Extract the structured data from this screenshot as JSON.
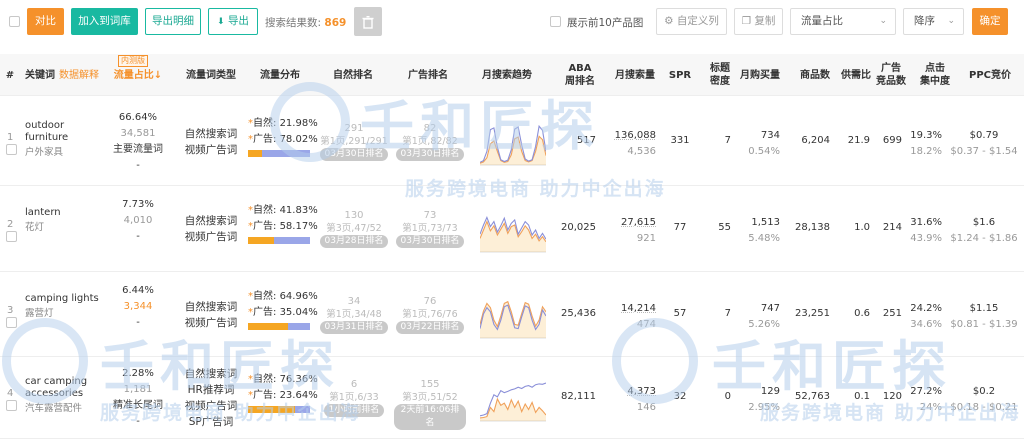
{
  "toolbar": {
    "compare": "对比",
    "add_to_lib": "加入到词库",
    "export_detail": "导出明细",
    "export": "导出",
    "result_label": "搜索结果数:",
    "result_count": "869",
    "top10_label": "展示前10产品图",
    "custom_cols": "自定义列",
    "copy": "复制",
    "sort_field": "流量占比",
    "sort_order": "降序",
    "confirm": "确定"
  },
  "header": {
    "index": "#",
    "keyword": "关键词",
    "data_explain": "数据解释",
    "beta": "内测版",
    "traffic_share": "流量占比↓",
    "traffic_type": "流量词类型",
    "traffic_dist": "流量分布",
    "natural_rank": "自然排名",
    "ad_rank": "广告排名",
    "monthly_trend": "月搜索趋势",
    "aba_1": "ABA",
    "aba_2": "周排名",
    "monthly_search": "月搜索量",
    "spr": "SPR",
    "title_density_1": "标题",
    "title_density_2": "密度",
    "monthly_purchase": "月购买量",
    "product_count": "商品数",
    "supply_demand": "供需比",
    "ad_products_1": "广告",
    "ad_products_2": "竞品数",
    "click_conc_1": "点击",
    "click_conc_2": "集中度",
    "ppc": "PPC竞价"
  },
  "rows": [
    {
      "index": "1",
      "keyword_en": "outdoor furniture",
      "keyword_cn": "户外家具",
      "share": "66.64%",
      "share_count": "34,581",
      "share_tag": "主要流量词",
      "share_dash": "-",
      "types": [
        "自然搜索词",
        "视频广告词"
      ],
      "natural_label": "自然:",
      "natural_pct": "21.98%",
      "ad_label": "广告:",
      "ad_pct": "78.02%",
      "natural_share": 0.2198,
      "nat_rank": "291",
      "nat_rank_sub": "第1页,291/291",
      "nat_rank_date": "03月30日排名",
      "ad_rank": "82",
      "ad_rank_sub": "第1页,82/82",
      "ad_rank_date": "03月30日排名",
      "trend_a": [
        4,
        8,
        30,
        82,
        86,
        40,
        10,
        6,
        9,
        34,
        83,
        88,
        45,
        12,
        7,
        10,
        42,
        90,
        80,
        30
      ],
      "trend_b": [
        2,
        5,
        15,
        48,
        55,
        30,
        8,
        4,
        6,
        22,
        60,
        64,
        30,
        8,
        5,
        8,
        30,
        66,
        58,
        20
      ],
      "aba": "517",
      "search": "136,088",
      "search_sub": "4,536",
      "spr": "331",
      "density": "7",
      "purchase": "734",
      "purchase_pct": "0.54%",
      "products": "6,204",
      "sd_ratio": "21.9",
      "ad_products": "699",
      "click_conc": "19.3%",
      "click_conc_sub": "18.2%",
      "ppc": "$0.79",
      "ppc_range": "$0.37 - $1.54"
    },
    {
      "index": "2",
      "keyword_en": "lantern",
      "keyword_cn": "花灯",
      "share": "7.73%",
      "share_count": "4,010",
      "share_tag": "",
      "share_dash": "-",
      "types": [
        "自然搜索词",
        "视频广告词"
      ],
      "natural_label": "自然:",
      "natural_pct": "41.83%",
      "ad_label": "广告:",
      "ad_pct": "58.17%",
      "natural_share": 0.4183,
      "nat_rank": "130",
      "nat_rank_sub": "第3页,47/52",
      "nat_rank_date": "03月28日排名",
      "ad_rank": "73",
      "ad_rank_sub": "第1页,73/73",
      "ad_rank_date": "03月30日排名",
      "trend_a": [
        40,
        62,
        80,
        58,
        70,
        45,
        60,
        78,
        50,
        66,
        74,
        40,
        55,
        70,
        62,
        38,
        50,
        30,
        42,
        28
      ],
      "trend_b": [
        30,
        50,
        70,
        48,
        60,
        38,
        52,
        66,
        42,
        58,
        62,
        34,
        46,
        60,
        50,
        30,
        40,
        24,
        34,
        22
      ],
      "aba": "20,025",
      "search": "27,615",
      "search_sub": "921",
      "spr": "77",
      "density": "55",
      "purchase": "1,513",
      "purchase_pct": "5.48%",
      "products": "28,138",
      "sd_ratio": "1.0",
      "ad_products": "214",
      "click_conc": "31.6%",
      "click_conc_sub": "43.9%",
      "ppc": "$1.6",
      "ppc_range": "$1.24 - $1.86"
    },
    {
      "index": "3",
      "keyword_en": "camping lights",
      "keyword_cn": "露营灯",
      "share": "6.44%",
      "share_count": "3,344",
      "share_tag": "",
      "share_dash": "-",
      "types": [
        "自然搜索词",
        "视频广告词"
      ],
      "natural_label": "自然:",
      "natural_pct": "64.96%",
      "ad_label": "广告:",
      "ad_pct": "35.04%",
      "natural_share": 0.6496,
      "nat_rank": "34",
      "nat_rank_sub": "第1页,34/48",
      "nat_rank_date": "03月31日排名",
      "ad_rank": "76",
      "ad_rank_sub": "第1页,76/76",
      "ad_rank_date": "03月22日排名",
      "trend_a": [
        20,
        55,
        70,
        60,
        30,
        18,
        40,
        72,
        76,
        50,
        22,
        20,
        48,
        74,
        70,
        40,
        18,
        30,
        64,
        50
      ],
      "trend_b": [
        30,
        62,
        80,
        70,
        40,
        25,
        50,
        80,
        84,
        60,
        30,
        28,
        56,
        82,
        78,
        50,
        26,
        40,
        72,
        60
      ],
      "aba": "25,436",
      "search": "14,214",
      "search_sub": "474",
      "spr": "57",
      "density": "7",
      "purchase": "747",
      "purchase_pct": "5.26%",
      "products": "23,251",
      "sd_ratio": "0.6",
      "ad_products": "251",
      "click_conc": "24.2%",
      "click_conc_sub": "34.6%",
      "ppc": "$1.15",
      "ppc_range": "$0.81 - $1.39"
    },
    {
      "index": "4",
      "keyword_en": "car camping accessories",
      "keyword_cn": "汽车露营配件",
      "share": "2.28%",
      "share_count": "1,181",
      "share_tag": "精准长尾词",
      "share_dash": "-",
      "types": [
        "自然搜索词",
        "HR推荐词",
        "视频广告词",
        "SP广告词"
      ],
      "natural_label": "自然:",
      "natural_pct": "76.36%",
      "ad_label": "广告:",
      "ad_pct": "23.64%",
      "natural_share": 0.7636,
      "nat_rank": "6",
      "nat_rank_sub": "第1页,6/33",
      "nat_rank_date": "1小时前排名",
      "ad_rank": "155",
      "ad_rank_sub": "第3页,51/52",
      "ad_rank_date": "2天前16:06排名",
      "trend_a": [
        10,
        12,
        15,
        40,
        60,
        55,
        70,
        65,
        68,
        72,
        74,
        78,
        75,
        80,
        82,
        78,
        84,
        86,
        85,
        88
      ],
      "trend_b": [
        5,
        6,
        8,
        30,
        20,
        50,
        35,
        40,
        25,
        48,
        30,
        45,
        20,
        38,
        25,
        42,
        18,
        30,
        22,
        12
      ],
      "aba": "82,111",
      "search": "4,373",
      "search_sub": "146",
      "spr": "32",
      "density": "0",
      "purchase": "129",
      "purchase_pct": "2.95%",
      "products": "52,763",
      "sd_ratio": "0.1",
      "ad_products": "120",
      "click_conc": "27.2%",
      "click_conc_sub": "24%",
      "ppc": "$0.2",
      "ppc_range": "$0.18 - $0.21"
    }
  ],
  "watermark": {
    "brand": "壬和匠探",
    "slogan": "服务跨境电商 助力中企出海"
  },
  "colors": {
    "orange": "#f5912b",
    "teal": "#19b9a1",
    "natural_bar": "#f5a623",
    "ad_bar": "#9aa6e8",
    "trend_a": "#8a8fd8",
    "trend_b": "#f0a15a"
  }
}
